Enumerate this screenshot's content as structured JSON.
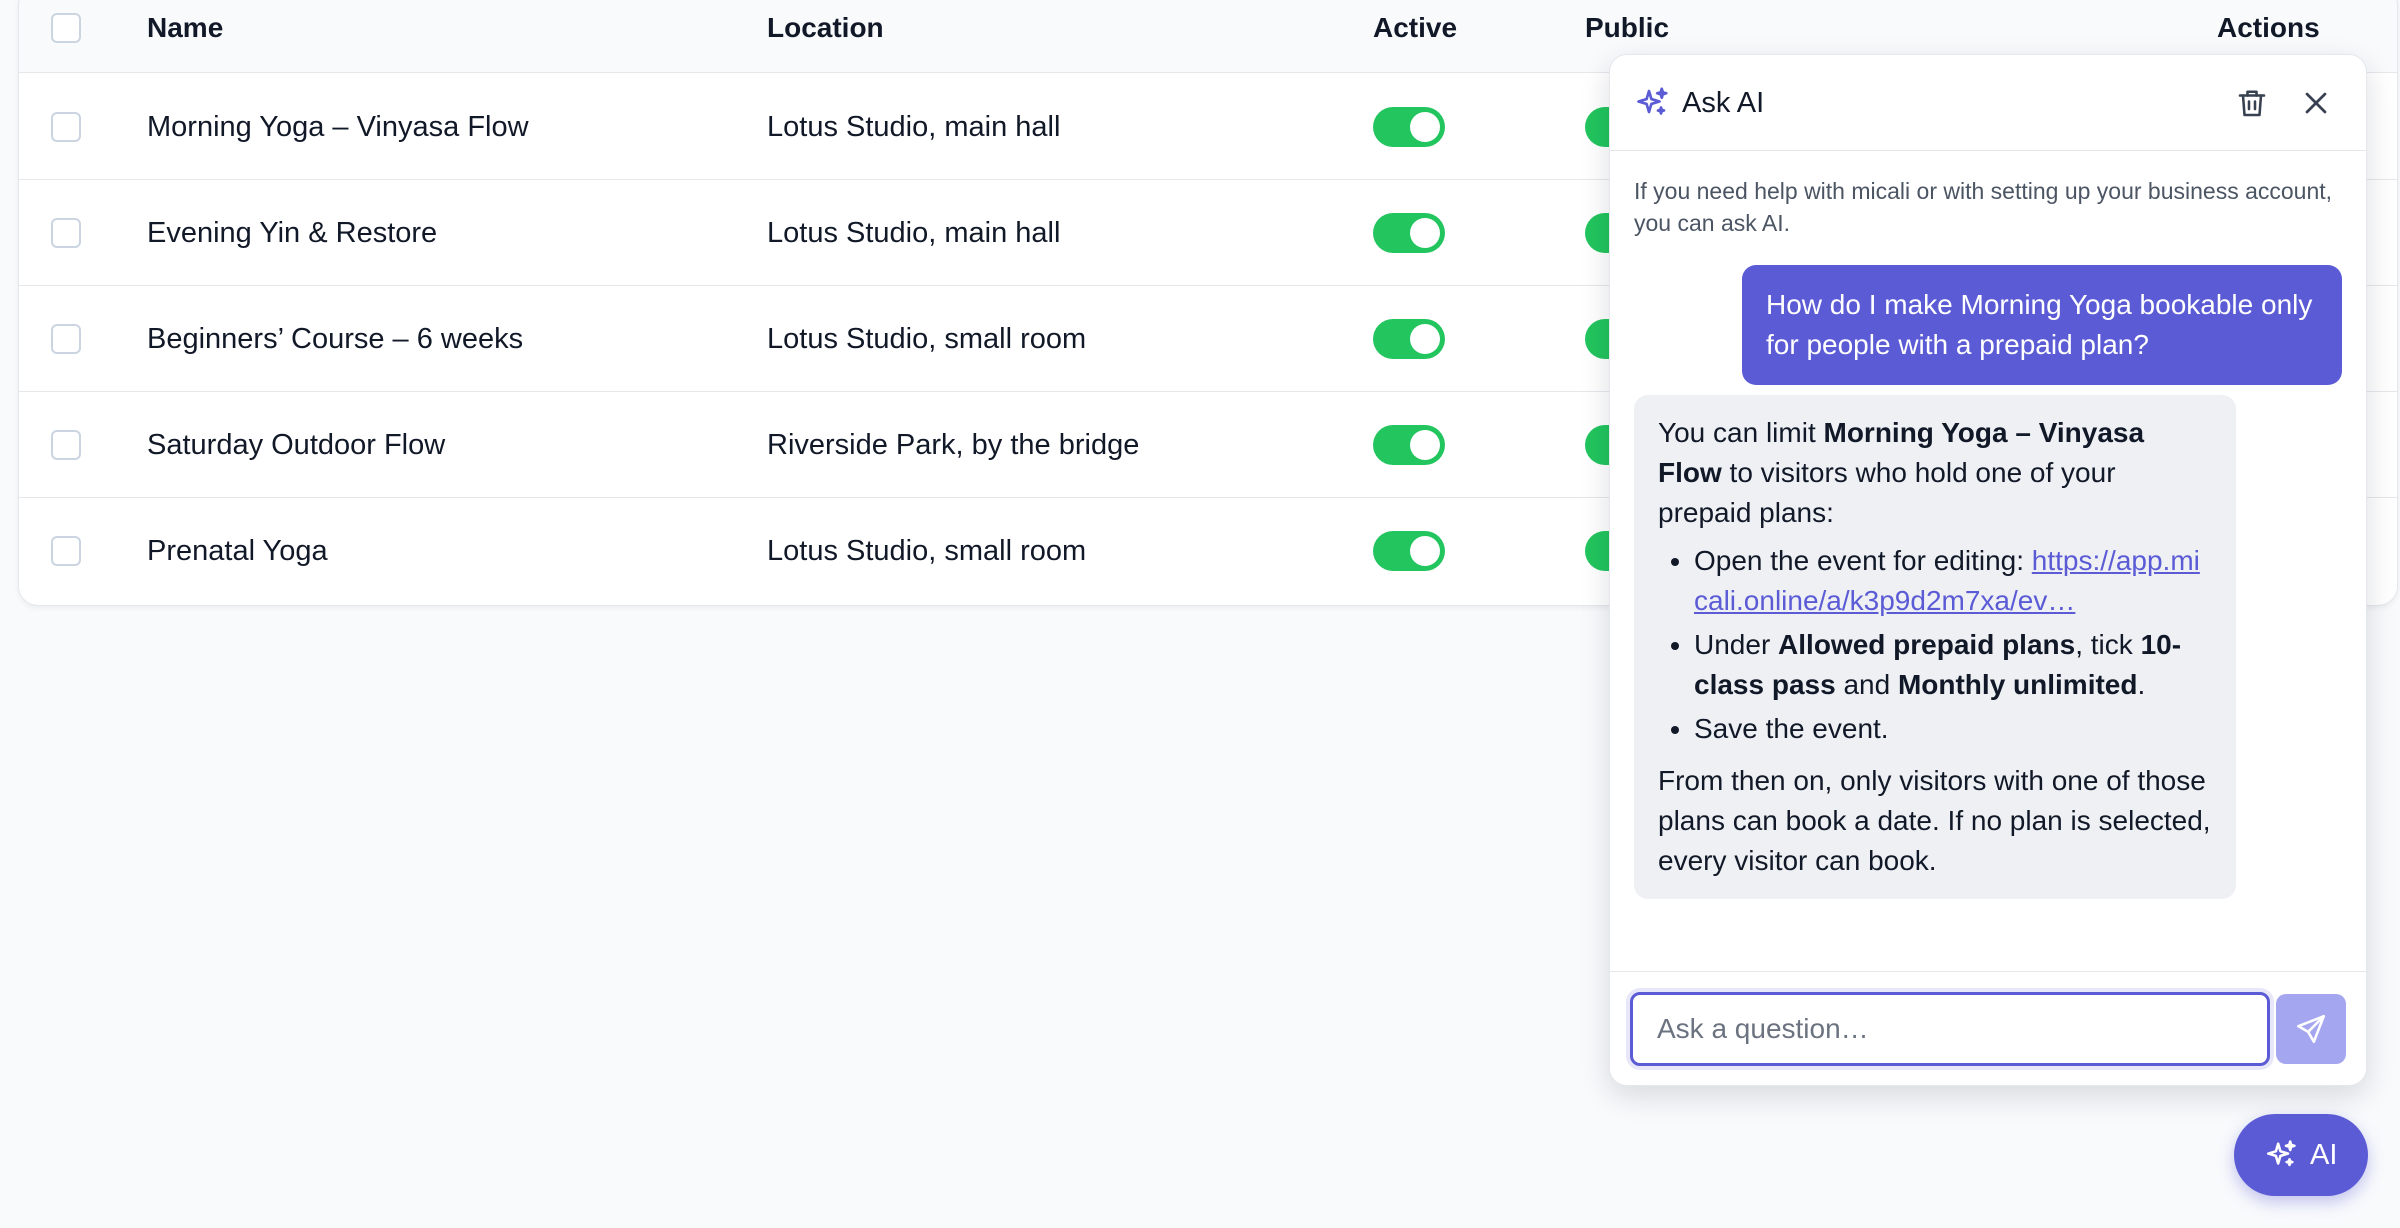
{
  "table": {
    "columns": {
      "name": "Name",
      "location": "Location",
      "active": "Active",
      "public": "Public",
      "actions": "Actions"
    },
    "rows": [
      {
        "name": "Morning Yoga – Vinyasa Flow",
        "location": "Lotus Studio, main hall",
        "active": true,
        "public": true
      },
      {
        "name": "Evening Yin & Restore",
        "location": "Lotus Studio, main hall",
        "active": true,
        "public": true
      },
      {
        "name": "Beginners’ Course – 6 weeks",
        "location": "Lotus Studio, small room",
        "active": true,
        "public": true
      },
      {
        "name": "Saturday Outdoor Flow",
        "location": "Riverside Park, by the bridge",
        "active": true,
        "public": true
      },
      {
        "name": "Prenatal Yoga",
        "location": "Lotus Studio, small room",
        "active": true,
        "public": true
      }
    ]
  },
  "ai_panel": {
    "title": "Ask AI",
    "intro": "If you need help with micali or with setting up your business account, you can ask AI.",
    "user_message": "How do I make Morning Yoga bookable only for people with a prepaid plan?",
    "reply": {
      "p1_a": "You can limit ",
      "p1_b": "Morning Yoga – Vinyasa Flow",
      "p1_c": " to visitors who hold one of your prepaid plans:",
      "b1_a": "Open the event for editing: ",
      "b1_link": "https://app.micali.online/a/k3p9d2m7xa/ev…",
      "b2_a": "Under ",
      "b2_b": "Allowed prepaid plans",
      "b2_c": ", tick ",
      "b2_d": "10-class pass",
      "b2_e": " and ",
      "b2_f": "Monthly unlimited",
      "b2_g": ".",
      "b3": "Save the event.",
      "p2": "From then on, only visitors with one of those plans can book a date. If no plan is selected, every visitor can book."
    },
    "input_placeholder": "Ask a question…"
  },
  "fab": {
    "label": "AI"
  },
  "colors": {
    "accent": "#5b5bd6",
    "toggle_on": "#22c55e",
    "send_disabled": "#a5a6f0"
  },
  "icons": {
    "panel": "sparkles-icon",
    "clear": "trash-icon",
    "close": "close-icon",
    "send": "send-icon",
    "fab": "sparkles-icon"
  }
}
